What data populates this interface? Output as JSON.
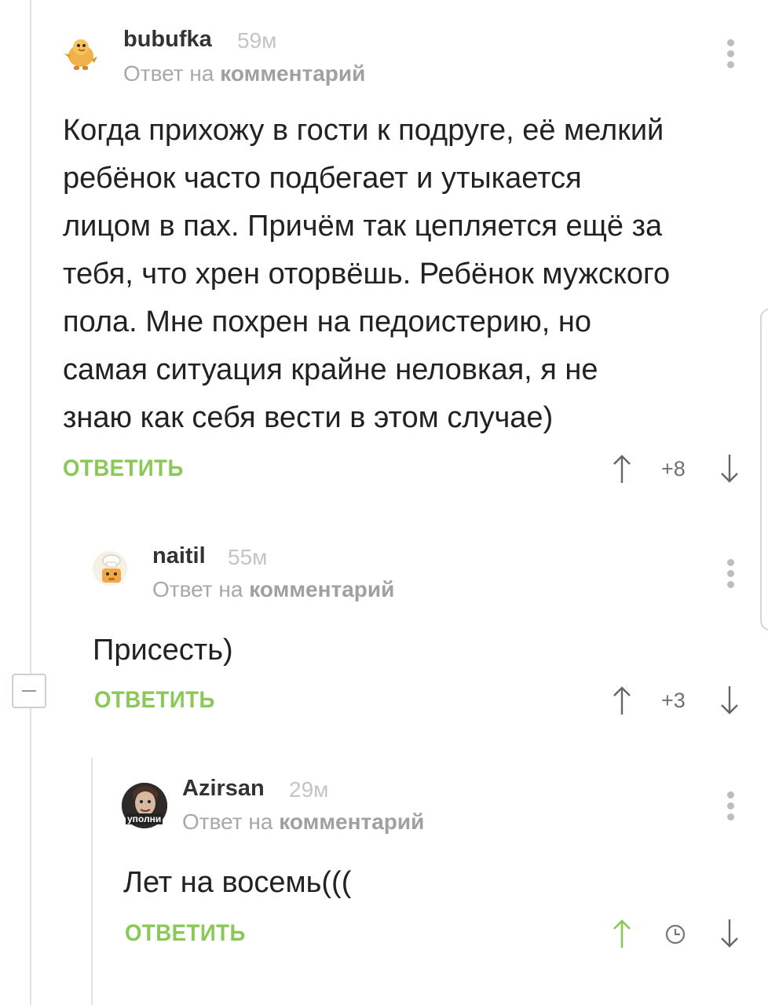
{
  "comments": [
    {
      "username": "bubufka",
      "time": "59м",
      "reply_prefix": "Ответ на",
      "reply_link": "комментарий",
      "body_lines": [
        "Когда прихожу в гости к подруге, её мелкий",
        "ребёнок часто подбегает и утыкается",
        "лицом в пах. Причём так цепляется ещё за",
        "тебя, что хрен оторвёшь. Ребёнок мужского",
        "пола. Мне похрен на педоистерию, но",
        "самая ситуация крайне неловкая, я не",
        "знаю как себя вести в этом случае)"
      ],
      "reply_label": "ОТВЕТИТЬ",
      "rating": "+8",
      "avatar_icon": "duck-avatar"
    },
    {
      "username": "naitil",
      "time": "55м",
      "reply_prefix": "Ответ на",
      "reply_link": "комментарий",
      "body_lines": [
        "Присесть)"
      ],
      "reply_label": "ОТВЕТИТЬ",
      "rating": "+3",
      "avatar_icon": "chef-avatar"
    },
    {
      "username": "Azirsan",
      "time": "29м",
      "reply_prefix": "Ответ на",
      "reply_link": "комментарий",
      "body_lines": [
        "Лет на восемь((("
      ],
      "reply_label": "ОТВЕТИТЬ",
      "rating_icon": "clock-icon",
      "avatar_icon": "photo-avatar",
      "avatar_caption": "уполни"
    }
  ],
  "colors": {
    "accent_green": "#8ac858",
    "meta_gray": "#a8a8a8",
    "text": "#222222"
  }
}
